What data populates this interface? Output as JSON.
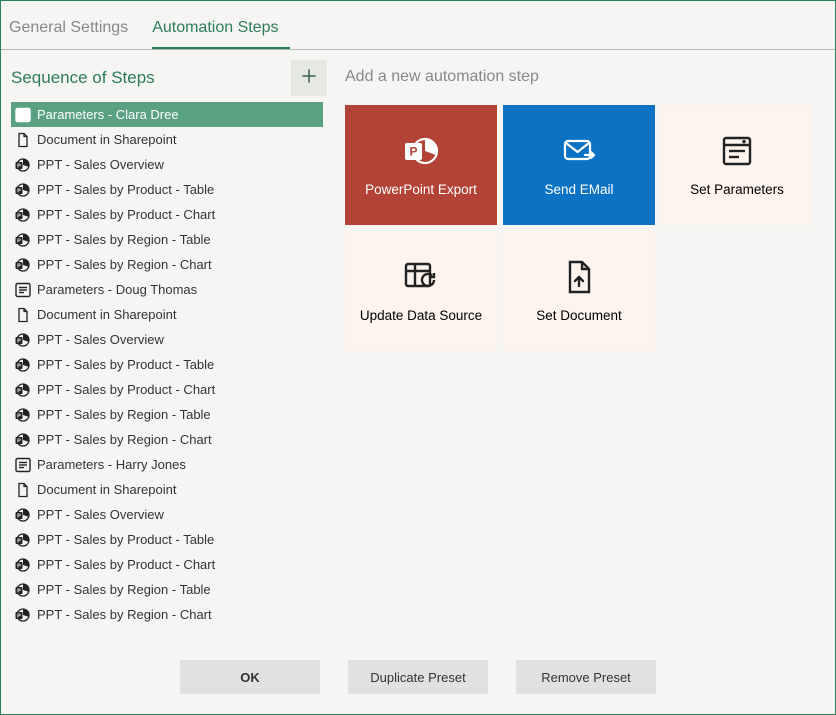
{
  "tabs": {
    "general": "General Settings",
    "automation": "Automation Steps"
  },
  "sequence": {
    "title": "Sequence of Steps",
    "items": [
      {
        "icon": "params",
        "label": "Parameters - Clara Dree",
        "selected": true
      },
      {
        "icon": "doc",
        "label": "Document in Sharepoint"
      },
      {
        "icon": "ppt",
        "label": "PPT - Sales Overview"
      },
      {
        "icon": "ppt",
        "label": "PPT - Sales by Product - Table"
      },
      {
        "icon": "ppt",
        "label": "PPT - Sales by Product - Chart"
      },
      {
        "icon": "ppt",
        "label": "PPT - Sales by Region - Table"
      },
      {
        "icon": "ppt",
        "label": "PPT - Sales by Region - Chart"
      },
      {
        "icon": "params",
        "label": "Parameters - Doug Thomas"
      },
      {
        "icon": "doc",
        "label": "Document in Sharepoint"
      },
      {
        "icon": "ppt",
        "label": "PPT - Sales Overview"
      },
      {
        "icon": "ppt",
        "label": "PPT - Sales by Product - Table"
      },
      {
        "icon": "ppt",
        "label": "PPT - Sales by Product - Chart"
      },
      {
        "icon": "ppt",
        "label": "PPT - Sales by Region - Table"
      },
      {
        "icon": "ppt",
        "label": "PPT - Sales by Region - Chart"
      },
      {
        "icon": "params",
        "label": "Parameters - Harry Jones"
      },
      {
        "icon": "doc",
        "label": "Document in Sharepoint"
      },
      {
        "icon": "ppt",
        "label": "PPT - Sales Overview"
      },
      {
        "icon": "ppt",
        "label": "PPT - Sales by Product - Table"
      },
      {
        "icon": "ppt",
        "label": "PPT - Sales by Product - Chart"
      },
      {
        "icon": "ppt",
        "label": "PPT - Sales by Region - Table"
      },
      {
        "icon": "ppt",
        "label": "PPT - Sales by Region - Chart"
      }
    ]
  },
  "right": {
    "title": "Add a new automation step",
    "tiles": [
      {
        "label": "PowerPoint Export",
        "icon": "ppt-export",
        "style": "red"
      },
      {
        "label": "Send EMail",
        "icon": "mail",
        "style": "blue"
      },
      {
        "label": "Set Parameters",
        "icon": "params-lg",
        "style": "plain"
      },
      {
        "label": "Update Data Source",
        "icon": "refresh",
        "style": "plain"
      },
      {
        "label": "Set Document",
        "icon": "doc-up",
        "style": "plain"
      }
    ]
  },
  "footer": {
    "ok": "OK",
    "duplicate": "Duplicate Preset",
    "remove": "Remove Preset"
  }
}
